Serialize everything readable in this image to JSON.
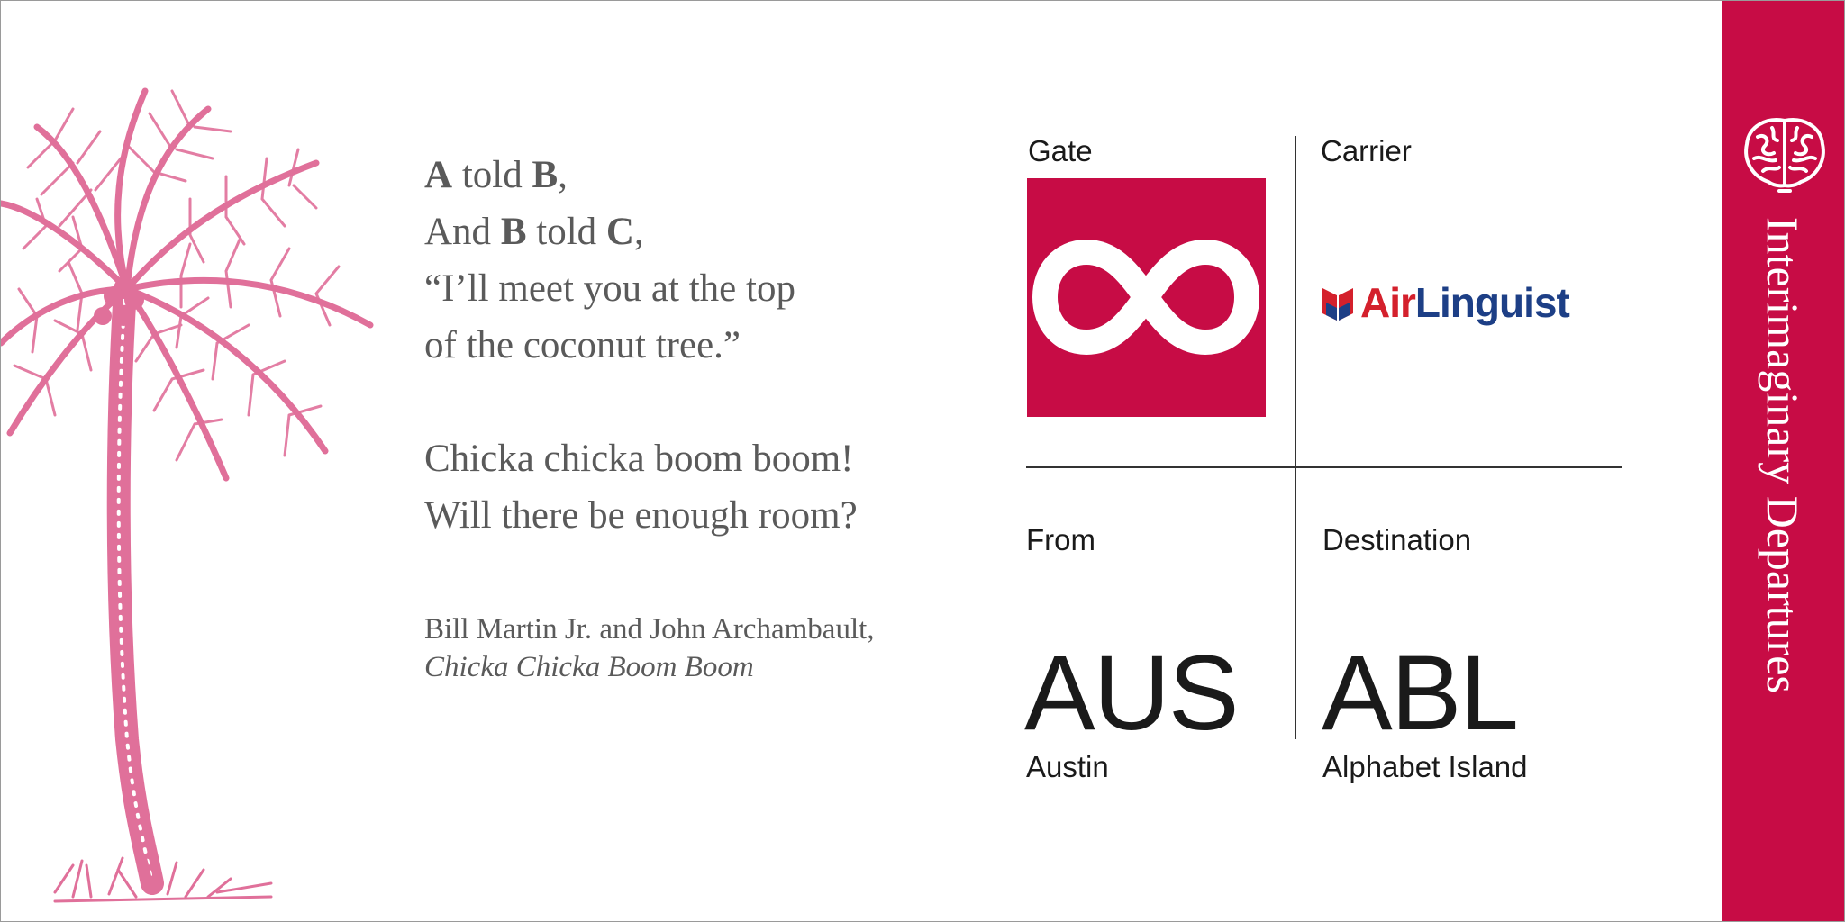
{
  "poem": {
    "l1_a": "A",
    "l1_mid": " told ",
    "l1_b": "B",
    "l1_end": ",",
    "l2_start": "And ",
    "l2_b": "B",
    "l2_mid": " told ",
    "l2_c": "C",
    "l2_end": ",",
    "l3": "“I’ll meet you at the top",
    "l4": "of the coconut tree.”",
    "l5": "Chicka chicka boom boom!",
    "l6": "Will there be enough room?"
  },
  "attribution": {
    "authors": "Bill Martin Jr. and John Archambault,",
    "book": "Chicka Chicka Boom Boom"
  },
  "ticket": {
    "gate_label": "Gate",
    "carrier_label": "Carrier",
    "carrier_name_a": "Air",
    "carrier_name_b": "Linguist",
    "from_label": "From",
    "from_code": "AUS",
    "from_city": "Austin",
    "dest_label": "Destination",
    "dest_code": "ABL",
    "dest_city": "Alphabet Island",
    "band_title": "Interimaginary Departures",
    "gate_icon": "infinity-icon",
    "band_icon": "brain-icon"
  },
  "colors": {
    "brand_crimson": "#c70c45",
    "palm_pink": "#e0709a",
    "logo_red": "#d4202c",
    "logo_blue": "#1d3f86",
    "poem_gray": "#5a5a5a"
  }
}
